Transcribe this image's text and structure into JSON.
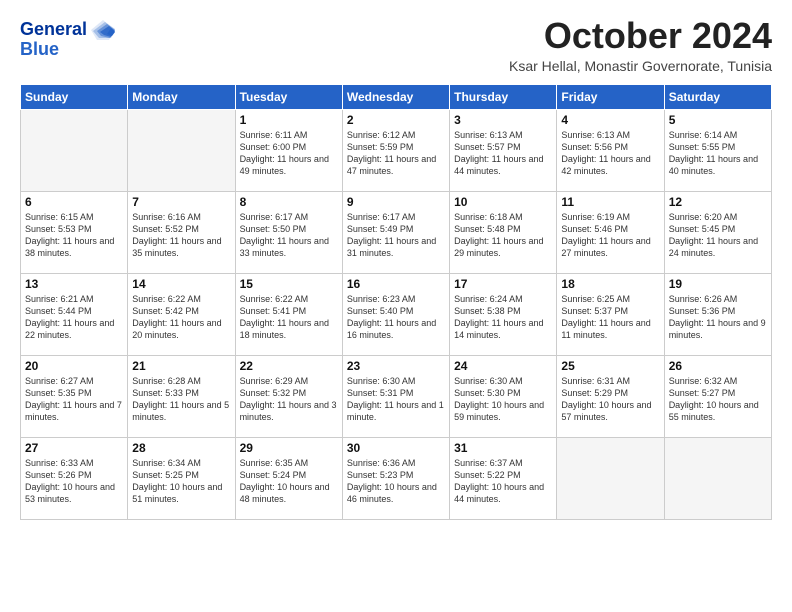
{
  "logo": {
    "line1": "General",
    "line2": "Blue"
  },
  "title": "October 2024",
  "subtitle": "Ksar Hellal, Monastir Governorate, Tunisia",
  "days": [
    "Sunday",
    "Monday",
    "Tuesday",
    "Wednesday",
    "Thursday",
    "Friday",
    "Saturday"
  ],
  "weeks": [
    [
      {
        "day": "",
        "content": ""
      },
      {
        "day": "",
        "content": ""
      },
      {
        "day": "1",
        "content": "Sunrise: 6:11 AM\nSunset: 6:00 PM\nDaylight: 11 hours and 49 minutes."
      },
      {
        "day": "2",
        "content": "Sunrise: 6:12 AM\nSunset: 5:59 PM\nDaylight: 11 hours and 47 minutes."
      },
      {
        "day": "3",
        "content": "Sunrise: 6:13 AM\nSunset: 5:57 PM\nDaylight: 11 hours and 44 minutes."
      },
      {
        "day": "4",
        "content": "Sunrise: 6:13 AM\nSunset: 5:56 PM\nDaylight: 11 hours and 42 minutes."
      },
      {
        "day": "5",
        "content": "Sunrise: 6:14 AM\nSunset: 5:55 PM\nDaylight: 11 hours and 40 minutes."
      }
    ],
    [
      {
        "day": "6",
        "content": "Sunrise: 6:15 AM\nSunset: 5:53 PM\nDaylight: 11 hours and 38 minutes."
      },
      {
        "day": "7",
        "content": "Sunrise: 6:16 AM\nSunset: 5:52 PM\nDaylight: 11 hours and 35 minutes."
      },
      {
        "day": "8",
        "content": "Sunrise: 6:17 AM\nSunset: 5:50 PM\nDaylight: 11 hours and 33 minutes."
      },
      {
        "day": "9",
        "content": "Sunrise: 6:17 AM\nSunset: 5:49 PM\nDaylight: 11 hours and 31 minutes."
      },
      {
        "day": "10",
        "content": "Sunrise: 6:18 AM\nSunset: 5:48 PM\nDaylight: 11 hours and 29 minutes."
      },
      {
        "day": "11",
        "content": "Sunrise: 6:19 AM\nSunset: 5:46 PM\nDaylight: 11 hours and 27 minutes."
      },
      {
        "day": "12",
        "content": "Sunrise: 6:20 AM\nSunset: 5:45 PM\nDaylight: 11 hours and 24 minutes."
      }
    ],
    [
      {
        "day": "13",
        "content": "Sunrise: 6:21 AM\nSunset: 5:44 PM\nDaylight: 11 hours and 22 minutes."
      },
      {
        "day": "14",
        "content": "Sunrise: 6:22 AM\nSunset: 5:42 PM\nDaylight: 11 hours and 20 minutes."
      },
      {
        "day": "15",
        "content": "Sunrise: 6:22 AM\nSunset: 5:41 PM\nDaylight: 11 hours and 18 minutes."
      },
      {
        "day": "16",
        "content": "Sunrise: 6:23 AM\nSunset: 5:40 PM\nDaylight: 11 hours and 16 minutes."
      },
      {
        "day": "17",
        "content": "Sunrise: 6:24 AM\nSunset: 5:38 PM\nDaylight: 11 hours and 14 minutes."
      },
      {
        "day": "18",
        "content": "Sunrise: 6:25 AM\nSunset: 5:37 PM\nDaylight: 11 hours and 11 minutes."
      },
      {
        "day": "19",
        "content": "Sunrise: 6:26 AM\nSunset: 5:36 PM\nDaylight: 11 hours and 9 minutes."
      }
    ],
    [
      {
        "day": "20",
        "content": "Sunrise: 6:27 AM\nSunset: 5:35 PM\nDaylight: 11 hours and 7 minutes."
      },
      {
        "day": "21",
        "content": "Sunrise: 6:28 AM\nSunset: 5:33 PM\nDaylight: 11 hours and 5 minutes."
      },
      {
        "day": "22",
        "content": "Sunrise: 6:29 AM\nSunset: 5:32 PM\nDaylight: 11 hours and 3 minutes."
      },
      {
        "day": "23",
        "content": "Sunrise: 6:30 AM\nSunset: 5:31 PM\nDaylight: 11 hours and 1 minute."
      },
      {
        "day": "24",
        "content": "Sunrise: 6:30 AM\nSunset: 5:30 PM\nDaylight: 10 hours and 59 minutes."
      },
      {
        "day": "25",
        "content": "Sunrise: 6:31 AM\nSunset: 5:29 PM\nDaylight: 10 hours and 57 minutes."
      },
      {
        "day": "26",
        "content": "Sunrise: 6:32 AM\nSunset: 5:27 PM\nDaylight: 10 hours and 55 minutes."
      }
    ],
    [
      {
        "day": "27",
        "content": "Sunrise: 6:33 AM\nSunset: 5:26 PM\nDaylight: 10 hours and 53 minutes."
      },
      {
        "day": "28",
        "content": "Sunrise: 6:34 AM\nSunset: 5:25 PM\nDaylight: 10 hours and 51 minutes."
      },
      {
        "day": "29",
        "content": "Sunrise: 6:35 AM\nSunset: 5:24 PM\nDaylight: 10 hours and 48 minutes."
      },
      {
        "day": "30",
        "content": "Sunrise: 6:36 AM\nSunset: 5:23 PM\nDaylight: 10 hours and 46 minutes."
      },
      {
        "day": "31",
        "content": "Sunrise: 6:37 AM\nSunset: 5:22 PM\nDaylight: 10 hours and 44 minutes."
      },
      {
        "day": "",
        "content": ""
      },
      {
        "day": "",
        "content": ""
      }
    ]
  ]
}
